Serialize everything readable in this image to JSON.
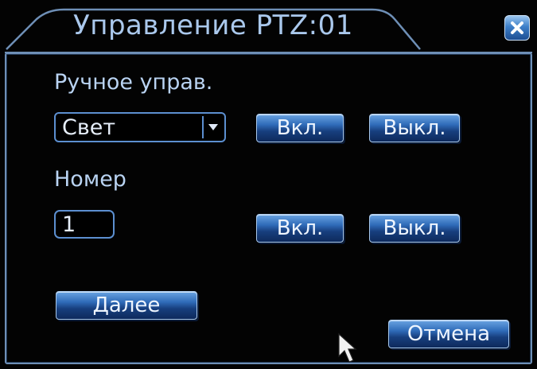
{
  "dialog": {
    "title": "Управление PTZ:01",
    "close_icon": "close-icon"
  },
  "manual": {
    "label": "Ручное управ.",
    "select_value": "Свет",
    "on_label": "Вкл.",
    "off_label": "Выкл."
  },
  "number": {
    "label": "Номер",
    "value": "1",
    "on_label": "Вкл.",
    "off_label": "Выкл."
  },
  "footer": {
    "next_label": "Далее",
    "cancel_label": "Отмена"
  },
  "colors": {
    "label_text": "#b9d3f2",
    "button_top": "#6aa4e2",
    "button_bottom": "#0e2a5c",
    "frame": "#6e8fb6"
  }
}
